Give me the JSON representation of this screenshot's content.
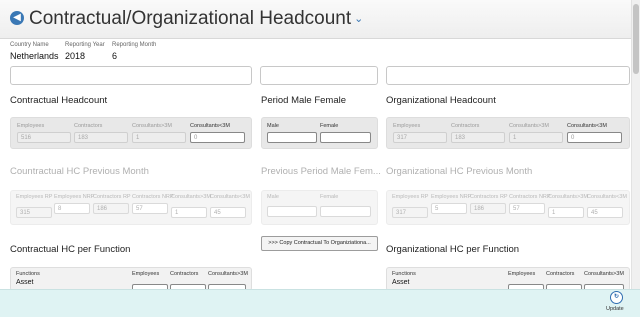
{
  "header": {
    "title": "Contractual/Organizational Headcount",
    "back_icon": "back-arrow-icon",
    "title_menu_icon": "chevron-down-icon"
  },
  "info": {
    "country": {
      "label": "Country Name",
      "value": "Netherlands"
    },
    "year": {
      "label": "Reporting Year",
      "value": "2018"
    },
    "month": {
      "label": "Reporting Month",
      "value": "6"
    }
  },
  "contractual": {
    "title": "Contractual Headcount",
    "fields": [
      {
        "label": "Employees",
        "value": "516"
      },
      {
        "label": "Contractors",
        "value": "183"
      },
      {
        "label": "Consultants>3M",
        "value": "1"
      },
      {
        "label": "Consultants<3M",
        "value": "0"
      }
    ]
  },
  "period": {
    "title": "Period Male Female",
    "fields": [
      {
        "label": "Male",
        "value": ""
      },
      {
        "label": "Female",
        "value": ""
      }
    ]
  },
  "organizational": {
    "title": "Organizational Headcount",
    "fields": [
      {
        "label": "Employees",
        "value": "317"
      },
      {
        "label": "Contractors",
        "value": "183"
      },
      {
        "label": "Consultants>3M",
        "value": "1"
      },
      {
        "label": "Consultants<3M",
        "value": "0"
      }
    ]
  },
  "contractual_prev": {
    "title": "Countractual HC Previous Month",
    "fields": [
      {
        "label": "Employees RP",
        "value": "315"
      },
      {
        "label": "Employees NRP",
        "value": "8"
      },
      {
        "label": "Contractors RP",
        "value": "186"
      },
      {
        "label": "Contractors NRP",
        "value": "57"
      },
      {
        "label": "Consultants>3M",
        "value": "1"
      },
      {
        "label": "Consultants<3M",
        "value": "45"
      }
    ]
  },
  "period_prev": {
    "title": "Previous Period Male Fem...",
    "fields": [
      {
        "label": "Male",
        "value": ""
      },
      {
        "label": "Female",
        "value": ""
      }
    ]
  },
  "organizational_prev": {
    "title": "Organizational HC Previous Month",
    "fields": [
      {
        "label": "Employees RP",
        "value": "317"
      },
      {
        "label": "Employees NRP",
        "value": "5"
      },
      {
        "label": "Contractors RP",
        "value": "186"
      },
      {
        "label": "Contractors NRP",
        "value": "57"
      },
      {
        "label": "Consultants>3M",
        "value": "1"
      },
      {
        "label": "Consultants<3M",
        "value": "45"
      }
    ]
  },
  "copy_button": {
    "label": ">>> Copy Contractual To Organiziationa..."
  },
  "contractual_func": {
    "title": "Contractual HC per Function",
    "col_functions": "Functions",
    "col_employees": "Employees",
    "col_contractors": "Contractors",
    "col_consultants": "Consultants>3M",
    "row1": "Asset"
  },
  "organizational_func": {
    "title": "Organizational HC per Function",
    "col_functions": "Functions",
    "col_employees": "Employees",
    "col_contractors": "Contractors",
    "col_consultants": "Consultants>3M",
    "row1": "Asset"
  },
  "footer": {
    "update_label": "Update",
    "update_icon": "refresh-circle-icon"
  },
  "colors": {
    "accent": "#3a78b5",
    "footer_bg": "#dff3f3"
  }
}
